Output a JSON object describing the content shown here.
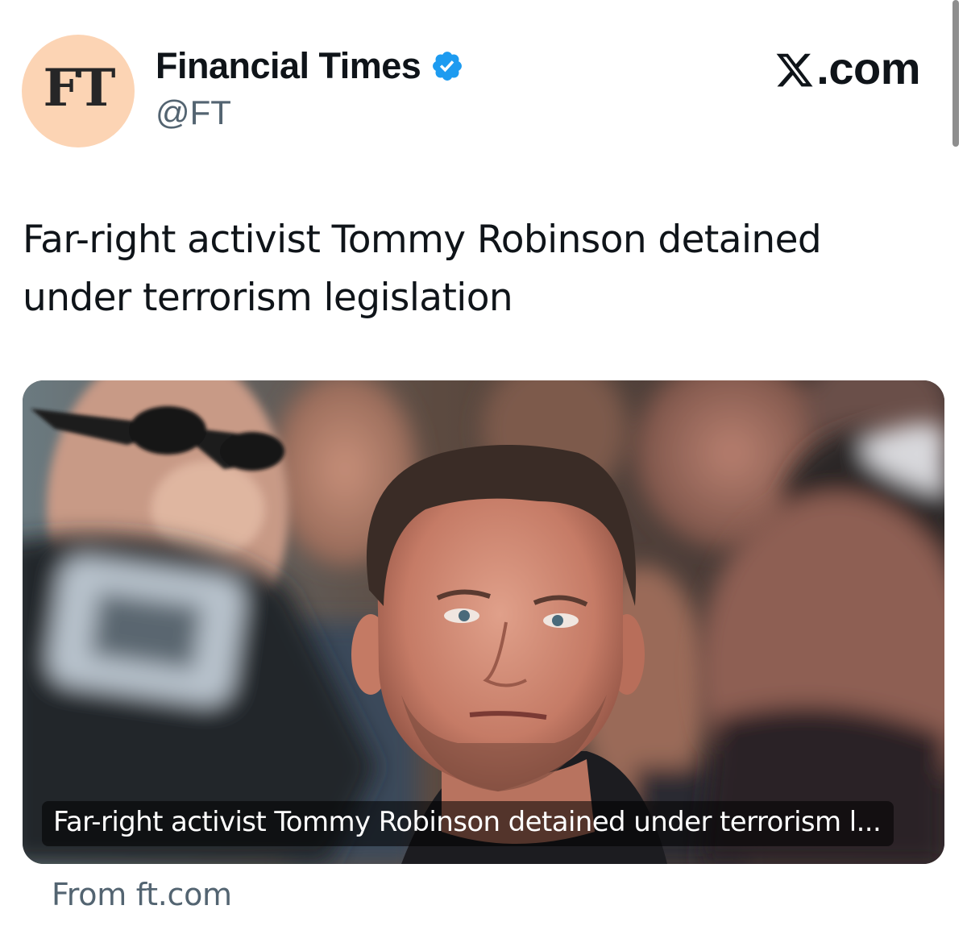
{
  "header": {
    "avatar_text": "FT",
    "account_name": "Financial Times",
    "account_handle": "@FT",
    "site_label": ".com",
    "verified_icon": "verified-badge-icon",
    "site_icon": "x-logo-icon"
  },
  "tweet": {
    "text": "Far-right activist Tommy Robinson detained under terrorism legislation"
  },
  "card": {
    "caption": "Far-right activist Tommy Robinson detained under terrorism l...",
    "source": "From ft.com"
  },
  "colors": {
    "avatar_bg": "#fcd4b4",
    "verified_blue": "#1d9bf0",
    "secondary_text": "#536471",
    "primary_text": "#0f1419"
  }
}
